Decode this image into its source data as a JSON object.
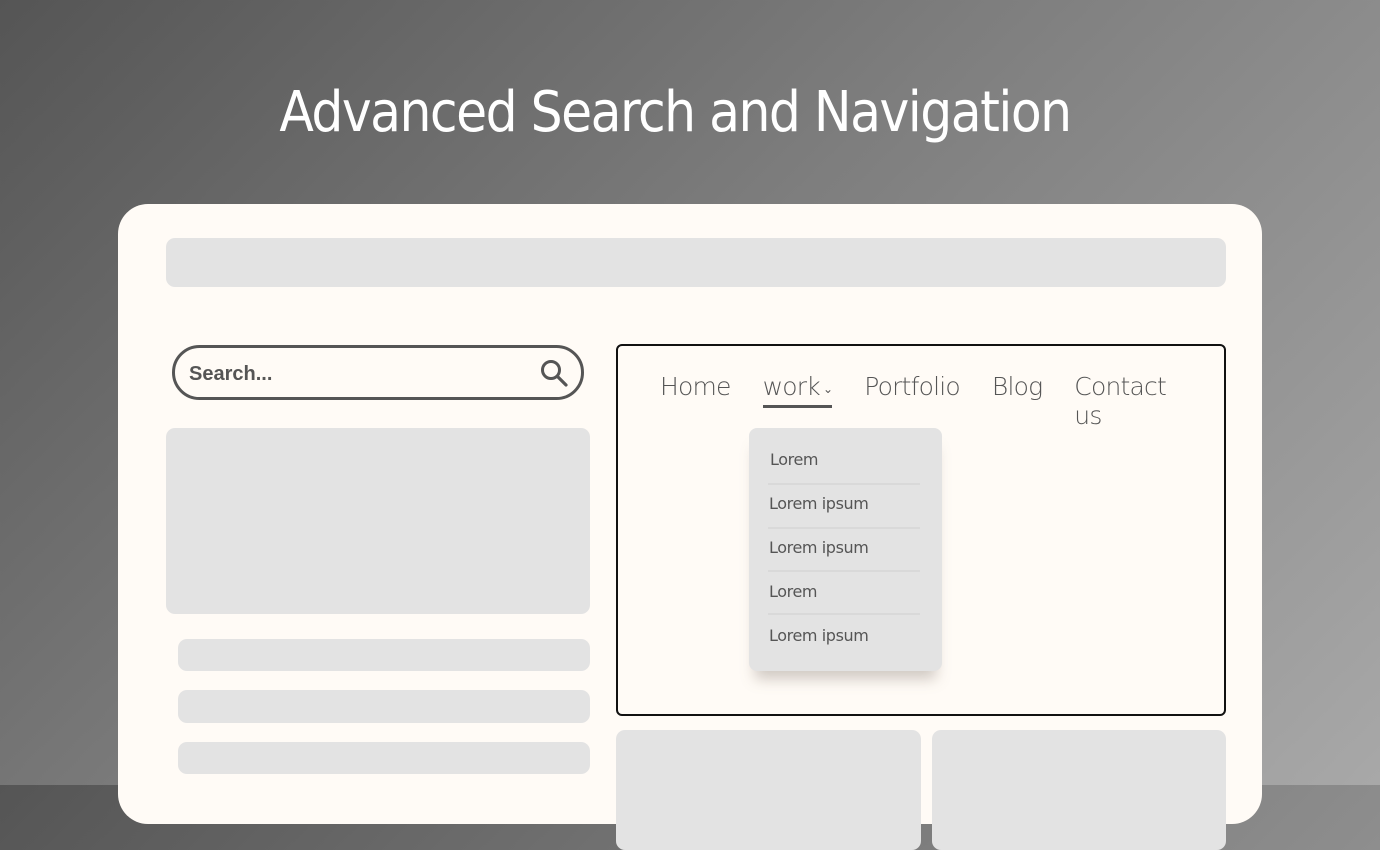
{
  "page": {
    "title": "Advanced Search and Navigation"
  },
  "search": {
    "placeholder": "Search...",
    "value": "",
    "icon": "search-icon"
  },
  "nav": {
    "items": [
      {
        "label": "Home"
      },
      {
        "label": "work",
        "active": true,
        "has_dropdown": true,
        "chevron": "⌄"
      },
      {
        "label": "Portfolio"
      },
      {
        "label": "Blog"
      },
      {
        "label": "Contact us"
      }
    ],
    "dropdown": {
      "items": [
        {
          "label": "Lorem"
        },
        {
          "label": "Lorem ipsum"
        },
        {
          "label": "Lorem ipsum"
        },
        {
          "label": "Lorem"
        },
        {
          "label": "Lorem ipsum"
        }
      ]
    }
  },
  "colors": {
    "card_bg": "#fffbf6",
    "placeholder_block": "#e3e3e3",
    "text": "#555555",
    "title": "#ffffff"
  }
}
